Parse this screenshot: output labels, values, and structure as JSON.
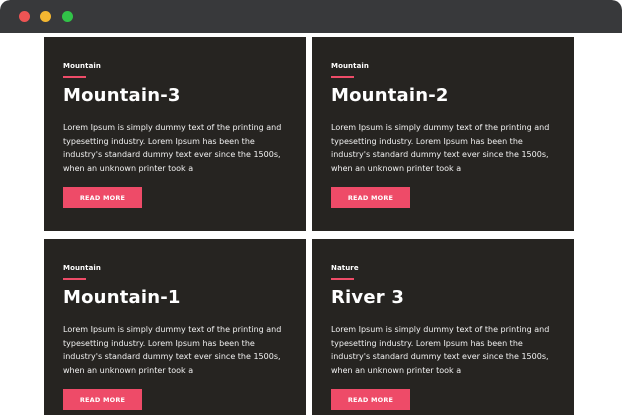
{
  "window": {
    "controls": [
      "close",
      "minimize",
      "maximize"
    ]
  },
  "cards": [
    {
      "category": "Mountain",
      "title": "Mountain-3",
      "description": "Lorem Ipsum is simply dummy text of the printing and typesetting industry. Lorem Ipsum has been the industry's standard dummy text ever since the 1500s, when an unknown printer took a",
      "button_label": "READ MORE"
    },
    {
      "category": "Mountain",
      "title": "Mountain-2",
      "description": "Lorem Ipsum is simply dummy text of the printing and typesetting industry. Lorem Ipsum has been the industry's standard dummy text ever since the 1500s, when an unknown printer took a",
      "button_label": "READ MORE"
    },
    {
      "category": "Mountain",
      "title": "Mountain-1",
      "description": "Lorem Ipsum is simply dummy text of the printing and typesetting industry. Lorem Ipsum has been the industry's standard dummy text ever since the 1500s, when an unknown printer took a",
      "button_label": "READ MORE"
    },
    {
      "category": "Nature",
      "title": "River 3",
      "description": "Lorem Ipsum is simply dummy text of the printing and typesetting industry. Lorem Ipsum has been the industry's standard dummy text ever since the 1500s, when an unknown printer took a",
      "button_label": "READ MORE"
    }
  ],
  "colors": {
    "titlebar": "#38393b",
    "card_background": "#262421",
    "accent": "#ee4b68",
    "close_dot": "#ed5454",
    "minimize_dot": "#f4b731",
    "maximize_dot": "#31c348"
  }
}
